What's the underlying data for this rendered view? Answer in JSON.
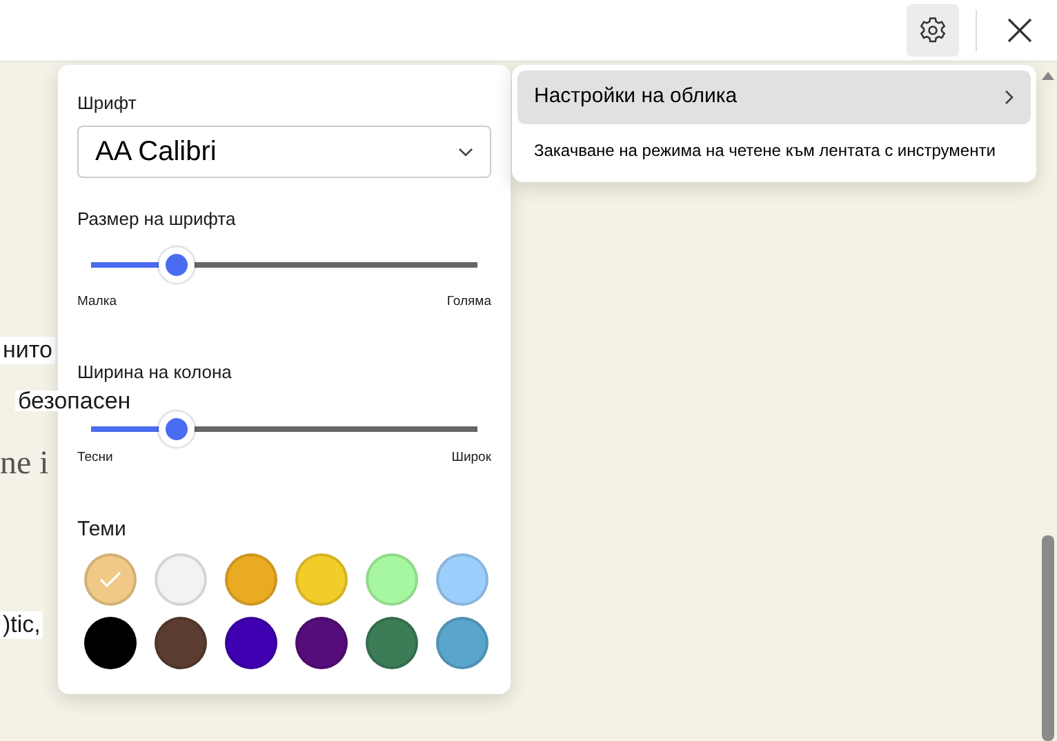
{
  "toolbar": {
    "settings_selected": true
  },
  "background_text": [
    "нито",
    "безопасен",
    "ne i",
    ")tic,"
  ],
  "menu": {
    "items": [
      {
        "label": "Настройки на облика",
        "selected": true,
        "kind": "submenu"
      },
      {
        "label": "Закачване на режима на четене към лентата с инструменти",
        "selected": false,
        "kind": "action"
      }
    ]
  },
  "panel": {
    "font_label": "Шрифт",
    "font_value": "AA Calibri",
    "sliders": [
      {
        "label": "Размер на шрифта",
        "level": 0.22,
        "min_label": "Малка",
        "max_label": "Голяма"
      },
      {
        "label": "Ширина на колона",
        "level": 0.22,
        "min_label": "Тесни",
        "max_label": "Широк"
      }
    ],
    "themes_label": "Теми",
    "themes": [
      {
        "color": "#f0c987",
        "selected": true
      },
      {
        "color": "#f2f2f2",
        "selected": false
      },
      {
        "color": "#eaab23",
        "selected": false
      },
      {
        "color": "#f2cd2a",
        "selected": false
      },
      {
        "color": "#a6f79f",
        "selected": false
      },
      {
        "color": "#9dcffc",
        "selected": false
      },
      {
        "color": "#000000",
        "selected": false
      },
      {
        "color": "#5a3d30",
        "selected": false
      },
      {
        "color": "#3f00b2",
        "selected": false
      },
      {
        "color": "#560d7c",
        "selected": false
      },
      {
        "color": "#3c7c57",
        "selected": false
      },
      {
        "color": "#5aa5cb",
        "selected": false
      }
    ]
  }
}
